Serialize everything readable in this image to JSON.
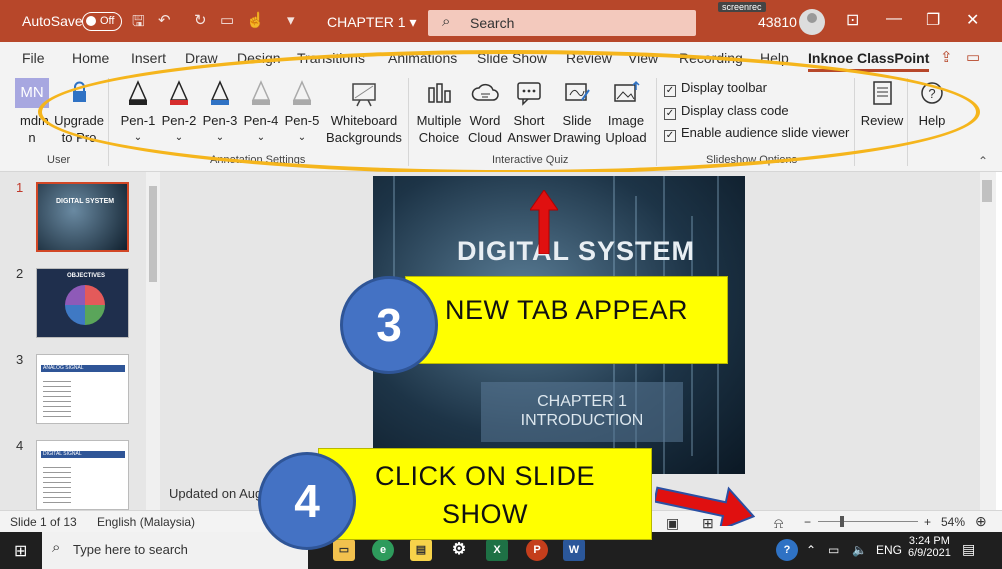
{
  "titlebar": {
    "autosave_label": "AutoSave",
    "autosave_state": "Off",
    "doc_title": "CHAPTER 1",
    "search_placeholder": "Search",
    "user_number": "43810",
    "screenrec_label": "screenrec"
  },
  "tabs": [
    {
      "label": "File"
    },
    {
      "label": "Home"
    },
    {
      "label": "Insert"
    },
    {
      "label": "Draw"
    },
    {
      "label": "Design"
    },
    {
      "label": "Transitions"
    },
    {
      "label": "Animations"
    },
    {
      "label": "Slide Show"
    },
    {
      "label": "Review"
    },
    {
      "label": "View"
    },
    {
      "label": "Recording"
    },
    {
      "label": "Help"
    },
    {
      "label": "Inknoe ClassPoint",
      "active": true
    }
  ],
  "ribbon": {
    "user_group": {
      "mdmn_label": "mdm n",
      "mn_initials": "MN",
      "upgrade_label": "Upgrade to Pro",
      "group_label": "User"
    },
    "pens": [
      "Pen-1",
      "Pen-2",
      "Pen-3",
      "Pen-4",
      "Pen-5"
    ],
    "pen_colors": [
      "#222222",
      "#d62c2c",
      "#2f72c4",
      "#aaaaaa",
      "#aaaaaa"
    ],
    "whiteboard_label": "Whiteboard Backgrounds",
    "annotation_group_label": "Annotation Settings",
    "quiz_buttons": [
      "Multiple Choice",
      "Word Cloud",
      "Short Answer",
      "Slide Drawing",
      "Image Upload"
    ],
    "quiz_group_label": "Interactive Quiz",
    "options": [
      "Display toolbar",
      "Display class code",
      "Enable audience slide viewer"
    ],
    "options_group_label": "Slideshow Options",
    "review_label": "Review",
    "help_label": "Help"
  },
  "slides": [
    {
      "number": "1",
      "title": "DIGITAL SYSTEM"
    },
    {
      "number": "2",
      "title": "OBJECTIVES"
    },
    {
      "number": "3",
      "title": "ANALOG SIGNAL"
    },
    {
      "number": "4",
      "title": "DIGITAL SIGNAL"
    }
  ],
  "current_slide": {
    "title": "DIGITAL SYSTEM",
    "subtitle_line1": "CHAPTER 1",
    "subtitle_line2": "INTRODUCTION"
  },
  "updated_text": "Updated on Aug 2",
  "status": {
    "slide_count": "Slide 1 of 13",
    "language": "English (Malaysia)",
    "zoom": "54%"
  },
  "callouts": {
    "step3_number": "3",
    "step3_text": "NEW TAB APPEAR",
    "step4_number": "4",
    "step4_text": "CLICK ON SLIDE SHOW"
  },
  "taskbar": {
    "search_placeholder": "Type here to search",
    "lang": "ENG",
    "time": "3:24 PM",
    "date": "6/9/2021"
  },
  "colors": {
    "accent": "#b7472a",
    "callout": "#ffff00",
    "circle": "#4472c4",
    "highlight_ellipse": "#f5b51c",
    "arrow": "#e01010"
  }
}
